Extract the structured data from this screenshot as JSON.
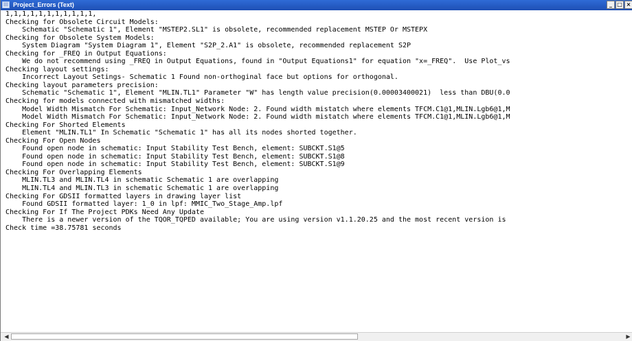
{
  "window": {
    "title": "Project_Errors (Text)",
    "controls": {
      "minimize": "_",
      "maximize": "□",
      "close": "×"
    }
  },
  "text_lines": [
    "1,1,1,1,1,1,1,1,1,1,1,",
    "Checking for Obsolete Circuit Models:",
    "    Schematic \"Schematic 1\", Element \"MSTEP2.SL1\" is obsolete, recommended replacement MSTEP Or MSTEPX",
    "Checking for Obsolete System Models:",
    "    System Diagram \"System Diagram 1\", Element \"S2P_2.A1\" is obsolete, recommended replacement S2P",
    "Checking for _FREQ in Output Equations:",
    "    We do not recommend using _FREQ in Output Equations, found in \"Output Equations1\" for equation \"x=_FREQ\".  Use Plot_vs",
    "Checking layout settings:",
    "    Incorrect Layout Setings- Schematic 1 Found non-orthoginal face but options for orthogonal.",
    "Checking layout parameters precision:",
    "    Schematic \"Schematic 1\", Element \"MLIN.TL1\" Parameter \"W\" has length value precision(0.00003400021)  less than DBU(0.0",
    "Checking for models connected with mismatched widths:",
    "    Model Width Mismatch For Schematic: Input_Network Node: 2. Found width mistatch where elements TFCM.C1@1,MLIN.Lgb6@1,M",
    "    Model Width Mismatch For Schematic: Input_Network Node: 2. Found width mistatch where elements TFCM.C1@1,MLIN.Lgb6@1,M",
    "Checking For Shorted Elements",
    "    Element \"MLIN.TL1\" In Schematic \"Schematic 1\" has all its nodes shorted together.",
    "Checking For Open Nodes",
    "    Found open node in schematic: Input Stability Test Bench, element: SUBCKT.S1@5",
    "    Found open node in schematic: Input Stability Test Bench, element: SUBCKT.S1@8",
    "    Found open node in schematic: Input Stability Test Bench, element: SUBCKT.S1@9",
    "Checking For Overlapping Elements",
    "    MLIN.TL3 and MLIN.TL4 in schematic Schematic 1 are overlapping",
    "    MLIN.TL4 and MLIN.TL3 in schematic Schematic 1 are overlapping",
    "Checking For GDSII formatted layers in drawing layer list",
    "    Found GDSII formatted layer: 1_0 in lpf: MMIC_Two_Stage_Amp.lpf",
    "Checking For If The Project PDKs Need Any Update",
    "    There is a newer version of the TQOR_TQPED available; You are using version v1.1.20.25 and the most recent version is",
    "Check time =38.75781 seconds"
  ],
  "scrollbar": {
    "left_arrow": "◀",
    "right_arrow": "▶"
  },
  "colors": {
    "titlebar": "#2f6bd6",
    "text": "#000000",
    "background": "#ffffff"
  }
}
